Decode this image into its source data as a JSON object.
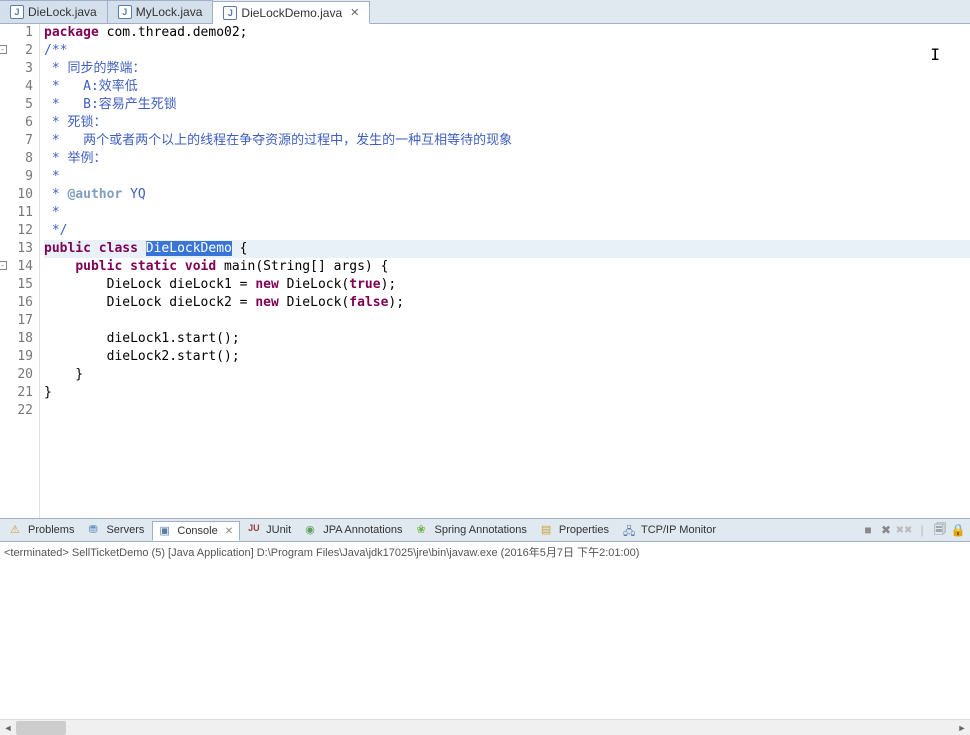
{
  "tabs": [
    {
      "label": "DieLock.java",
      "active": false
    },
    {
      "label": "MyLock.java",
      "active": false
    },
    {
      "label": "DieLockDemo.java",
      "active": true
    }
  ],
  "code": {
    "lines": [
      {
        "n": "1",
        "segs": [
          {
            "t": "package",
            "c": "kw"
          },
          {
            "t": " com.thread.demo02;",
            "c": ""
          }
        ]
      },
      {
        "n": "2",
        "fold": "-",
        "segs": [
          {
            "t": "/**",
            "c": "cm"
          }
        ]
      },
      {
        "n": "3",
        "segs": [
          {
            "t": " * ",
            "c": "cm"
          },
          {
            "t": "同步的弊端：",
            "c": "cm"
          }
        ]
      },
      {
        "n": "4",
        "segs": [
          {
            "t": " *   A:",
            "c": "cm"
          },
          {
            "t": "效率低",
            "c": "cm"
          }
        ]
      },
      {
        "n": "5",
        "segs": [
          {
            "t": " *   B:",
            "c": "cm"
          },
          {
            "t": "容易产生死锁",
            "c": "cm"
          }
        ]
      },
      {
        "n": "6",
        "segs": [
          {
            "t": " * ",
            "c": "cm"
          },
          {
            "t": "死锁：",
            "c": "cm"
          }
        ]
      },
      {
        "n": "7",
        "segs": [
          {
            "t": " *   ",
            "c": "cm"
          },
          {
            "t": "两个或者两个以上的线程在争夺资源的过程中，发生的一种互相等待的现象",
            "c": "cm"
          }
        ]
      },
      {
        "n": "8",
        "segs": [
          {
            "t": " * ",
            "c": "cm"
          },
          {
            "t": "举例：",
            "c": "cm"
          }
        ]
      },
      {
        "n": "9",
        "segs": [
          {
            "t": " * ",
            "c": "cm"
          }
        ]
      },
      {
        "n": "10",
        "segs": [
          {
            "t": " * ",
            "c": "cm"
          },
          {
            "t": "@author",
            "c": "cmtag"
          },
          {
            "t": " YQ",
            "c": "cm"
          }
        ]
      },
      {
        "n": "11",
        "segs": [
          {
            "t": " *",
            "c": "cm"
          }
        ]
      },
      {
        "n": "12",
        "segs": [
          {
            "t": " */",
            "c": "cm"
          }
        ]
      },
      {
        "n": "13",
        "hl": true,
        "segs": [
          {
            "t": "public",
            "c": "kw"
          },
          {
            "t": " ",
            "c": ""
          },
          {
            "t": "class",
            "c": "kw"
          },
          {
            "t": " ",
            "c": ""
          },
          {
            "t": "DieLockDemo",
            "c": "sel"
          },
          {
            "t": " {",
            "c": ""
          }
        ]
      },
      {
        "n": "14",
        "fold": "-",
        "segs": [
          {
            "t": "    ",
            "c": ""
          },
          {
            "t": "public",
            "c": "kw"
          },
          {
            "t": " ",
            "c": ""
          },
          {
            "t": "static",
            "c": "kw"
          },
          {
            "t": " ",
            "c": ""
          },
          {
            "t": "void",
            "c": "kw"
          },
          {
            "t": " main(String[] args) {",
            "c": ""
          }
        ]
      },
      {
        "n": "15",
        "segs": [
          {
            "t": "        DieLock dieLock1 = ",
            "c": ""
          },
          {
            "t": "new",
            "c": "kw"
          },
          {
            "t": " DieLock(",
            "c": ""
          },
          {
            "t": "true",
            "c": "kw"
          },
          {
            "t": ");",
            "c": ""
          }
        ]
      },
      {
        "n": "16",
        "segs": [
          {
            "t": "        DieLock dieLock2 = ",
            "c": ""
          },
          {
            "t": "new",
            "c": "kw"
          },
          {
            "t": " DieLock(",
            "c": ""
          },
          {
            "t": "false",
            "c": "kw"
          },
          {
            "t": ");",
            "c": ""
          }
        ]
      },
      {
        "n": "17",
        "segs": []
      },
      {
        "n": "18",
        "segs": [
          {
            "t": "        dieLock1.start();",
            "c": ""
          }
        ]
      },
      {
        "n": "19",
        "segs": [
          {
            "t": "        dieLock2.start();",
            "c": ""
          }
        ]
      },
      {
        "n": "20",
        "segs": [
          {
            "t": "    }",
            "c": ""
          }
        ]
      },
      {
        "n": "21",
        "segs": [
          {
            "t": "}",
            "c": ""
          }
        ]
      },
      {
        "n": "22",
        "segs": []
      }
    ]
  },
  "views": [
    {
      "label": "Problems",
      "icon": "ic-problems",
      "active": false
    },
    {
      "label": "Servers",
      "icon": "ic-servers",
      "active": false
    },
    {
      "label": "Console",
      "icon": "ic-console",
      "active": true
    },
    {
      "label": "JUnit",
      "icon": "ic-junit",
      "active": false,
      "prefix": "JU"
    },
    {
      "label": "JPA Annotations",
      "icon": "ic-jpa",
      "active": false
    },
    {
      "label": "Spring Annotations",
      "icon": "ic-spring",
      "active": false
    },
    {
      "label": "Properties",
      "icon": "ic-prop",
      "active": false
    },
    {
      "label": "TCP/IP Monitor",
      "icon": "ic-tcp",
      "active": false
    }
  ],
  "console": {
    "status": "<terminated> SellTicketDemo (5) [Java Application] D:\\Program Files\\Java\\jdk17025\\jre\\bin\\javaw.exe (2016年5月7日 下午2:01:00)"
  },
  "toolbar_icons": {
    "remove_launch": "■",
    "remove_all": "✖",
    "remove_all2": "✖✖",
    "sep": "|",
    "pin": "📋",
    "lock": "🔒"
  }
}
